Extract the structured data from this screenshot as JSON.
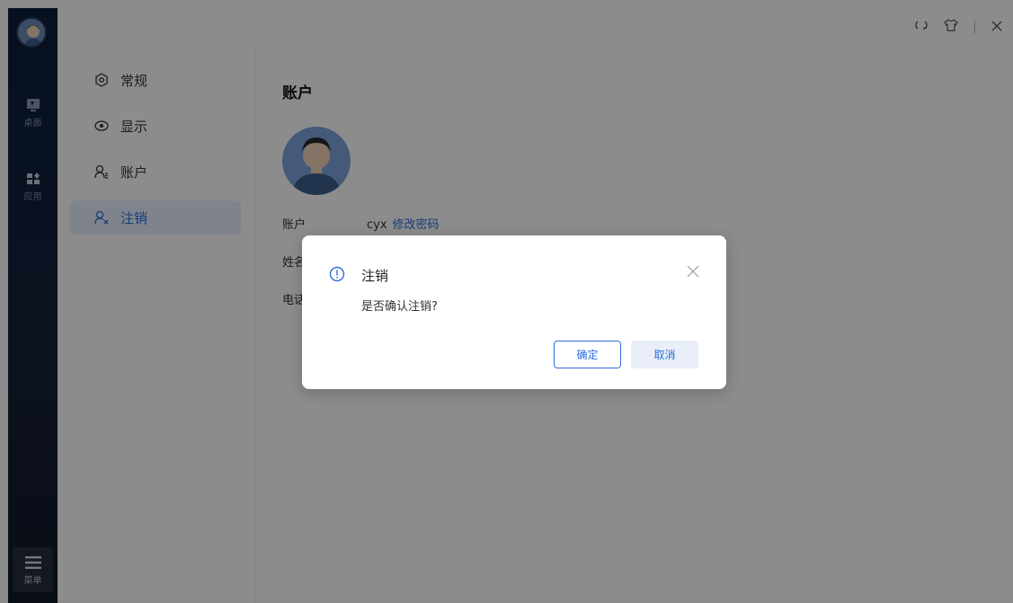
{
  "rail": {
    "desktop_label": "桌面",
    "apps_label": "应用",
    "menu_label": "菜单"
  },
  "nav": {
    "items": [
      {
        "label": "常规",
        "icon": "settings-icon"
      },
      {
        "label": "显示",
        "icon": "eye-icon"
      },
      {
        "label": "账户",
        "icon": "user-icon"
      },
      {
        "label": "注销",
        "icon": "logout-user-icon",
        "active": true
      }
    ]
  },
  "content": {
    "title": "账户",
    "rows": [
      {
        "label": "账户",
        "value": "cyx",
        "link": "修改密码"
      },
      {
        "label": "姓名",
        "value": ""
      },
      {
        "label": "电话",
        "value": ""
      }
    ]
  },
  "dialog": {
    "title": "注销",
    "message": "是否确认注销?",
    "ok_label": "确定",
    "cancel_label": "取消"
  },
  "colors": {
    "accent": "#2b6fdc",
    "rail_bg": "#15213b",
    "nav_active_bg": "#e8f0ff"
  }
}
